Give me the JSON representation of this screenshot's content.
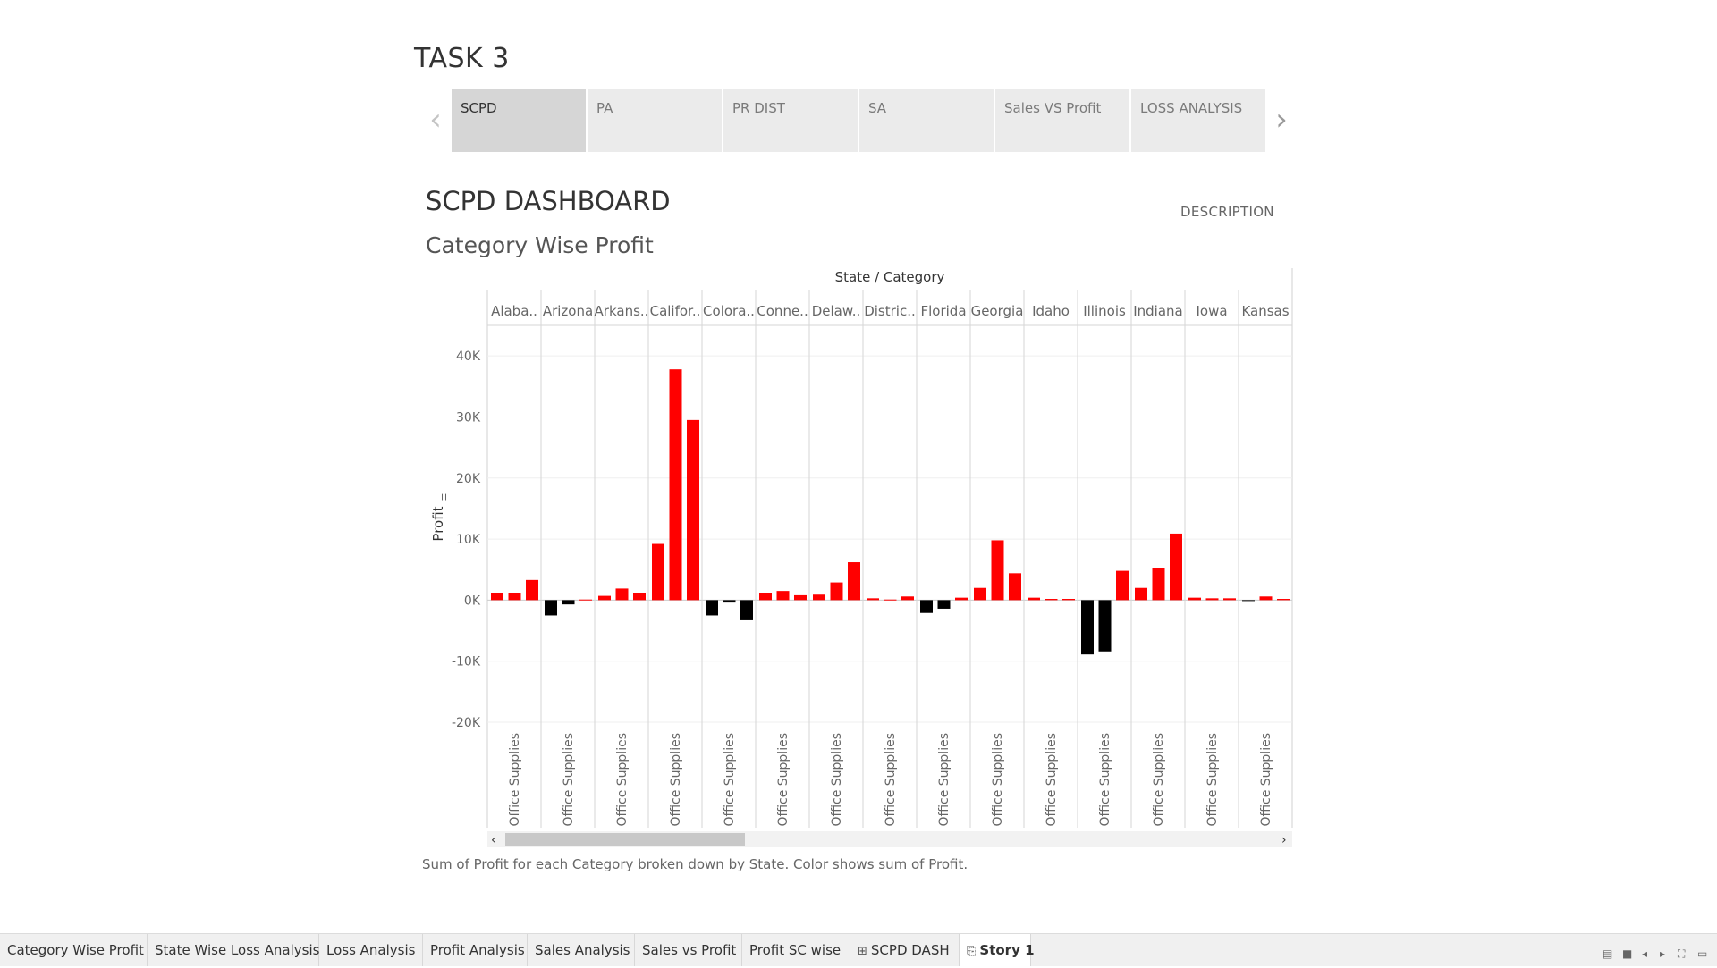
{
  "story": {
    "title": "TASK 3",
    "prev_label": "‹",
    "next_label": "›",
    "points": [
      {
        "label": "SCPD",
        "active": true
      },
      {
        "label": "PA",
        "active": false
      },
      {
        "label": "PR DIST",
        "active": false
      },
      {
        "label": "SA",
        "active": false
      },
      {
        "label": "Sales VS Profit",
        "active": false
      },
      {
        "label": "LOSS ANALYSIS",
        "active": false
      }
    ]
  },
  "dashboard": {
    "title": "SCPD DASHBOARD",
    "description_label": "DESCRIPTION",
    "sheet_title": "Category Wise Profit",
    "caption": "Sum of Profit for each Category broken down by State.  Color shows sum of Profit."
  },
  "chart_data": {
    "type": "bar",
    "header_title": "State / Category",
    "ylabel": "Profit",
    "ylim": [
      -20000,
      45000
    ],
    "yticks": [
      {
        "value": 40000,
        "label": "40K"
      },
      {
        "value": 30000,
        "label": "30K"
      },
      {
        "value": 20000,
        "label": "20K"
      },
      {
        "value": 10000,
        "label": "10K"
      },
      {
        "value": 0,
        "label": "0K"
      },
      {
        "value": -10000,
        "label": "-10K"
      },
      {
        "value": -20000,
        "label": "-20K"
      }
    ],
    "category_label": "Office Supplies",
    "color_positive": "#ff0000",
    "color_negative": "#000000",
    "grid": true,
    "states": [
      {
        "label": "Alaba..",
        "values": [
          1100,
          1100,
          3300
        ]
      },
      {
        "label": "Arizona",
        "values": [
          -2500,
          -700,
          100
        ]
      },
      {
        "label": "Arkans..",
        "values": [
          700,
          1900,
          1200
        ]
      },
      {
        "label": "Califor..",
        "values": [
          9200,
          37800,
          29500
        ]
      },
      {
        "label": "Colora..",
        "values": [
          -2500,
          -400,
          -3300
        ]
      },
      {
        "label": "Conne..",
        "values": [
          1100,
          1500,
          800
        ]
      },
      {
        "label": "Delaw..",
        "values": [
          900,
          2900,
          6200
        ]
      },
      {
        "label": "Distric..",
        "values": [
          300,
          100,
          600
        ]
      },
      {
        "label": "Florida",
        "values": [
          -2100,
          -1400,
          400
        ]
      },
      {
        "label": "Georgia",
        "values": [
          2000,
          9800,
          4400
        ]
      },
      {
        "label": "Idaho",
        "values": [
          400,
          200,
          200
        ]
      },
      {
        "label": "Illinois",
        "values": [
          -8900,
          -8400,
          4800
        ]
      },
      {
        "label": "Indiana",
        "values": [
          2000,
          5300,
          10900
        ]
      },
      {
        "label": "Iowa",
        "values": [
          400,
          300,
          300
        ]
      },
      {
        "label": "Kansas",
        "values": [
          -100,
          600,
          200
        ]
      }
    ]
  },
  "sheet_tabs": [
    {
      "label": "Category Wise Profit",
      "icon": "",
      "icon_name": "",
      "active": false
    },
    {
      "label": "State Wise Loss Analysis",
      "icon": "",
      "icon_name": "",
      "active": false
    },
    {
      "label": "Loss Analysis",
      "icon": "",
      "icon_name": "",
      "active": false
    },
    {
      "label": "Profit Analysis",
      "icon": "",
      "icon_name": "",
      "active": false
    },
    {
      "label": "Sales Analysis",
      "icon": "",
      "icon_name": "",
      "active": false
    },
    {
      "label": "Sales vs Profit",
      "icon": "",
      "icon_name": "",
      "active": false
    },
    {
      "label": "Profit SC wise",
      "icon": "",
      "icon_name": "",
      "active": false
    },
    {
      "label": "SCPD DASH",
      "icon": "⊞",
      "icon_name": "dashboard-icon",
      "active": false
    },
    {
      "label": "Story 1",
      "icon": "⎘",
      "icon_name": "story-icon",
      "active": true
    }
  ]
}
